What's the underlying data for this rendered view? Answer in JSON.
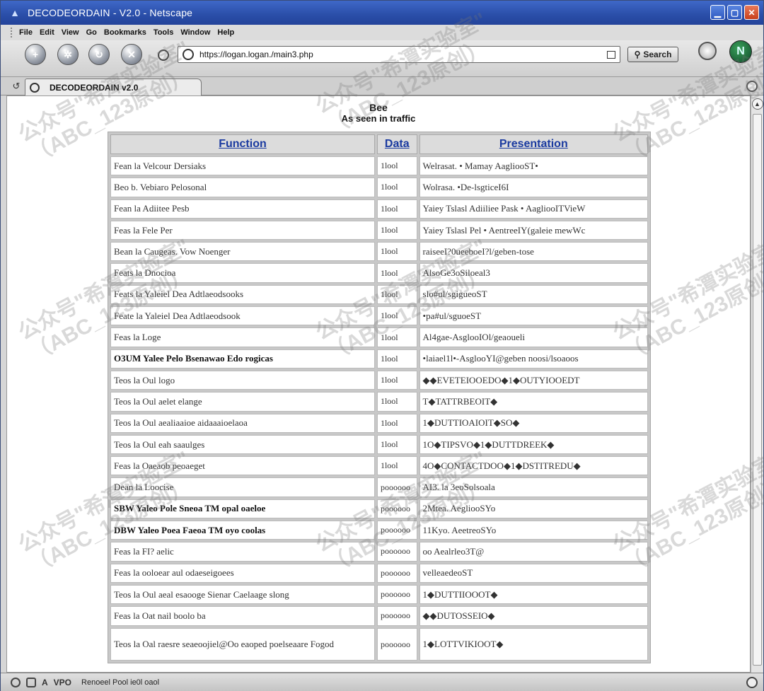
{
  "window": {
    "title": "DECODEORDAIN - V2.0 - Netscape",
    "controls": [
      "minimize-icon",
      "maximize-icon",
      "close-icon"
    ]
  },
  "menu": [
    "File",
    "Edit",
    "View",
    "Go",
    "Bookmarks",
    "Tools",
    "Window",
    "Help"
  ],
  "nav": {
    "url": "https://logan.logan./main3.php",
    "search_label": "Search",
    "throbber_letter": "N"
  },
  "tab": {
    "label": "DECODEORDAIN v2.0"
  },
  "page": {
    "title": "Bee",
    "subtitle": "As seen in traffic"
  },
  "table": {
    "headers": {
      "function": "Function",
      "data": "Data",
      "presentation": "Presentation"
    },
    "rows": [
      {
        "function": "Fean la Velcour Dersiaks",
        "data": "1lool",
        "presentation": "Welrasat. • Mamay AagliooST•"
      },
      {
        "function": "Beo b. Vebiaro Pelosonal",
        "data": "1lool",
        "presentation": "Wolrasa. •De-lsgticeI6I"
      },
      {
        "function": "Fean la Adiitee Pesb",
        "data": "1lool",
        "presentation": "Yaiey Tslasl Adiiliee Pask • AagliooITVieW"
      },
      {
        "function": "Feas la Fele Per",
        "data": "1lool",
        "presentation": "Yaiey Tslasl Pel • AentreeIY(galeie mewWc"
      },
      {
        "function": "Bean la Caugeas. Vow Noenger",
        "data": "1lool",
        "presentation": "raiseeI?0ueeboeI?l/geben-tose"
      },
      {
        "function": "Feats la Dnocioa",
        "data": "1lool",
        "presentation": "AlsoGe3oSiloeal3"
      },
      {
        "function": "Feats la Yaleiel Dea Adtlaeodsooks",
        "data": "1lool",
        "presentation": "slo#ul/sgigueoST"
      },
      {
        "function": "Feate la Yaleiel Dea Adtlaeodsook",
        "data": "1lool",
        "presentation": "•pa#ul/sguoeST"
      },
      {
        "function": "Feas la Loge",
        "data": "1lool",
        "presentation": "Al4gae-AsglooIOl/geaoueli"
      },
      {
        "function": "O3UM Yalee Pelo Bsenawao Edo rogicas",
        "data": "1lool",
        "presentation": "•laiael1l•-AsglooYI@geben noosi/lsoaoos"
      },
      {
        "function": "Teos la Oul logo",
        "data": "1lool",
        "presentation": "◆◆EVETEIOOEDO◆1◆OUTYIOOEDT"
      },
      {
        "function": "Teos la Oul aelet elange",
        "data": "1lool",
        "presentation": "T◆TATTRBEOIT◆"
      },
      {
        "function": "Teos la Oul aealiaaioe aidaaaioelaoa",
        "data": "1lool",
        "presentation": "1◆DUTTIOAIOIT◆SO◆"
      },
      {
        "function": "Teos la Oul eah saaulges",
        "data": "1lool",
        "presentation": "1O◆TIPSVO◆1◆DUTTDREEK◆"
      },
      {
        "function": "Feas la Oaeaob peoaeget",
        "data": "1lool",
        "presentation": "4O◆CONTACTDOO◆1◆DSTITREDU◆"
      },
      {
        "function": "Dean la Loocise",
        "data": "poooooo",
        "presentation": "AI3. la 3eoSolsoala"
      },
      {
        "function": "SBW Yaleo Pole Sneoa TM opal oaeloe",
        "data": "poooooo",
        "presentation": "2Mtea. AegliooSYo"
      },
      {
        "function": "DBW Yaleo Poea Faeoa TM oyo coolas",
        "data": "poooooo",
        "presentation": "11Kyo. AeetreoSYo"
      },
      {
        "function": "Feas la FI? aelic",
        "data": "poooooo",
        "presentation": "oo Aealrleo3T@"
      },
      {
        "function": "Feas la ooloear aul odaeseigoees",
        "data": "poooooo",
        "presentation": "velleaedeoST"
      },
      {
        "function": "Teos la Oul aeal esaooge Sienar Caelaage slong",
        "data": "poooooo",
        "presentation": "1◆DUTTIIOOOT◆"
      },
      {
        "function": "Feas la Oat nail boolo ba",
        "data": "poooooo",
        "presentation": "◆◆DUTOSSEIO◆"
      },
      {
        "function": "Teos la Oal raesre seaeoojiel@Oo eaoped poelseaare Fogod",
        "data": "poooooo",
        "presentation": "1◆LOTTVIKIOOT◆"
      }
    ]
  },
  "status": {
    "text": "Renoeel Pool ie0l oaol"
  },
  "watermark": {
    "line1": "公众号\"希潭实验室\"",
    "line2": "（ABC_123原创）"
  }
}
